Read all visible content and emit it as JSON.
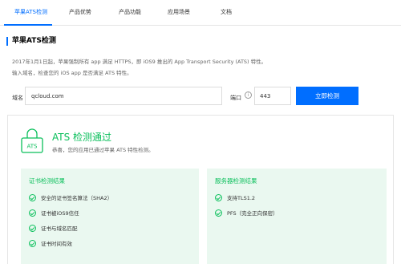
{
  "tabs": [
    {
      "label": "苹果ATS检测",
      "active": true
    },
    {
      "label": "产品优势",
      "active": false
    },
    {
      "label": "产品功能",
      "active": false
    },
    {
      "label": "应用场景",
      "active": false
    },
    {
      "label": "文档",
      "active": false
    }
  ],
  "section": {
    "title": "苹果ATS检测"
  },
  "description": {
    "line1": "2017年1月1日起，苹果强制所有 app 满足 HTTPS，即 iOS9 推出的 App Transport Security (ATS) 特性。",
    "line2": "输入域名，检查您的 iOS app 是否满足 ATS 特性。"
  },
  "form": {
    "domain_label": "域名",
    "domain_value": "qcloud.com",
    "port_label": "端口",
    "info_icon": "i",
    "port_value": "443",
    "submit_label": "立即检测"
  },
  "result": {
    "badge_text": "ATS",
    "title": "ATS 检测通过",
    "subtitle": "恭喜，您的应用已通过苹果 ATS 特性检测。",
    "status_color": "#0abf5b"
  },
  "cert_card": {
    "title": "证书检测结果",
    "items": [
      "安全的证书签名算法（SHA2）",
      "证书被iOS9信任",
      "证书与域名匹配",
      "证书时间有效"
    ]
  },
  "server_card": {
    "title": "服务器检测结果",
    "items": [
      "支持TLS1.2",
      "PFS（完全正向保密）"
    ]
  },
  "colors": {
    "accent": "#006eff",
    "success": "#0abf5b",
    "card_bg": "#eaf8f0"
  }
}
